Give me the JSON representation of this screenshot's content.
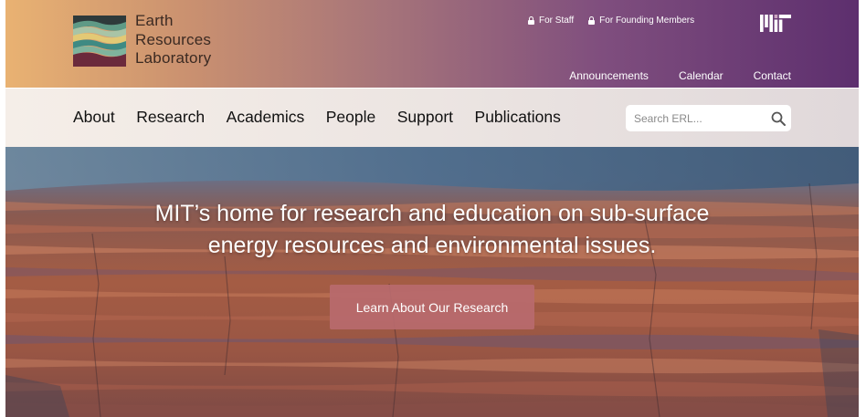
{
  "header": {
    "logo": {
      "line1": "Earth",
      "line2": "Resources",
      "line3": "Laboratory"
    },
    "utility_links": [
      {
        "label": "For Staff",
        "icon": "lock-icon"
      },
      {
        "label": "For Founding Members",
        "icon": "lock-icon"
      }
    ],
    "mit_logo_icon": "mit-logo-icon",
    "sub_links": [
      "Announcements",
      "Calendar",
      "Contact"
    ]
  },
  "nav": {
    "items": [
      "About",
      "Research",
      "Academics",
      "People",
      "Support",
      "Publications"
    ],
    "search": {
      "placeholder": "Search ERL...",
      "icon": "search-icon"
    }
  },
  "hero": {
    "heading_line1": "MIT’s home for research and education on sub-surface",
    "heading_line2": "energy resources and environmental issues.",
    "button_label": "Learn About Our Research"
  },
  "colors": {
    "header_gradient_start": "#e9b272",
    "header_gradient_end": "#5d2f6e",
    "nav_background": "#f0e9e5",
    "hero_button": "#b86a6e",
    "nav_text": "#111111"
  }
}
